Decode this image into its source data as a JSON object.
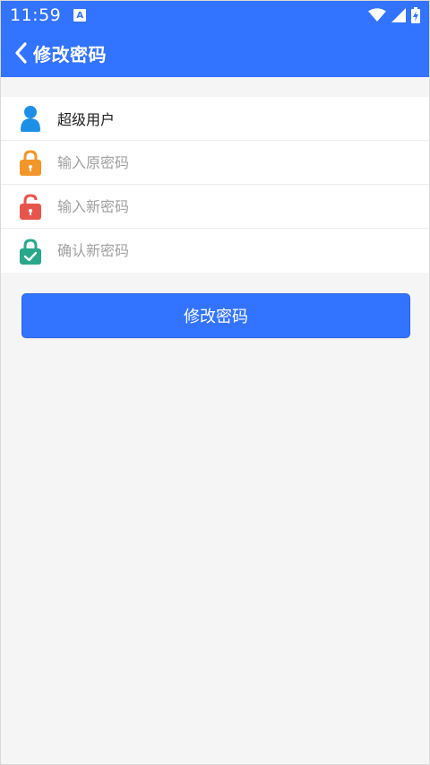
{
  "status_bar": {
    "time": "11:59",
    "notification_icon_letter": "A"
  },
  "header": {
    "title": "修改密码"
  },
  "form": {
    "username": "超级用户",
    "old_password_placeholder": "输入原密码",
    "new_password_placeholder": "输入新密码",
    "confirm_password_placeholder": "确认新密码"
  },
  "submit_label": "修改密码",
  "colors": {
    "primary": "#3273ff",
    "user_icon": "#1d8fe6",
    "lock_orange": "#f3962a",
    "lock_red": "#e6554b",
    "lock_green": "#2aa78a",
    "background": "#f5f5f5"
  },
  "icons": {
    "user": "user-icon",
    "old_password": "lock-closed-icon",
    "new_password": "lock-open-icon",
    "confirm_password": "lock-check-icon"
  }
}
